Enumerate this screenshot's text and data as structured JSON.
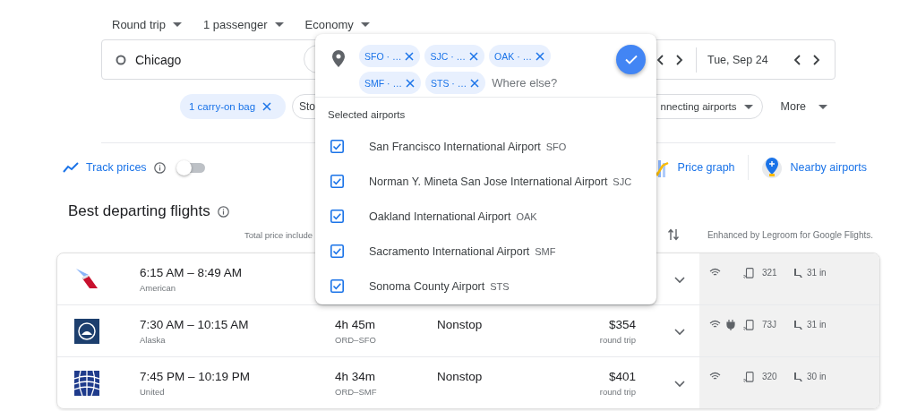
{
  "trip_options": [
    {
      "label": "Round trip"
    },
    {
      "label": "1 passenger"
    },
    {
      "label": "Economy"
    }
  ],
  "search": {
    "origin": "Chicago",
    "return_date": "Tue, Sep 24"
  },
  "filters": [
    {
      "label": "1 carry-on bag",
      "kind": "applied"
    },
    {
      "label": "Sto",
      "kind": "outlined"
    },
    {
      "label": "nnecting airports",
      "kind": "outlined"
    },
    {
      "label": "More",
      "kind": "plain"
    }
  ],
  "track_prices": {
    "label": "Track prices",
    "on": false
  },
  "tools": [
    {
      "label": "Price graph",
      "kind": "graph"
    },
    {
      "label": "Nearby airports",
      "kind": "nearby"
    }
  ],
  "results": {
    "title": "Best departing flights",
    "note": "Total price include",
    "credit": "Enhanced by Legroom for Google Flights.",
    "flights": [
      {
        "times": "6:15 AM – 8:49 AM",
        "airline": "American",
        "logo": {
          "kind": "tail"
        },
        "amenities": [
          {
            "kind": "wifi"
          },
          {
            "kind": "stream"
          }
        ],
        "aircraft": "321",
        "legroom": "31 in"
      },
      {
        "times": "7:30 AM – 10:15 AM",
        "airline": "Alaska",
        "logo": {
          "kind": "badge"
        },
        "duration": "4h 45m",
        "route": "ORD–SFO",
        "stops": "Nonstop",
        "price": "$354",
        "price_note": "round trip",
        "amenities": [
          {
            "kind": "wifi"
          },
          {
            "kind": "power"
          },
          {
            "kind": "stream"
          }
        ],
        "aircraft": "73J",
        "legroom": "31 in"
      },
      {
        "times": "7:45 PM – 10:19 PM",
        "airline": "United",
        "logo": {
          "kind": "globe"
        },
        "duration": "4h 34m",
        "route": "ORD–SMF",
        "stops": "Nonstop",
        "price": "$401",
        "price_note": "round trip",
        "amenities": [
          {
            "kind": "wifi"
          },
          {
            "kind": "stream"
          }
        ],
        "aircraft": "320",
        "legroom": "30 in"
      }
    ]
  },
  "destination_picker": {
    "chips": [
      {
        "label": "SFO · …"
      },
      {
        "label": "SJC · …"
      },
      {
        "label": "OAK · …"
      },
      {
        "label": "SMF · …"
      },
      {
        "label": "STS · …"
      }
    ],
    "placeholder": "Where else?",
    "section_title": "Selected airports",
    "airports": [
      {
        "name": "San Francisco International Airport",
        "code": "SFO",
        "checked": true
      },
      {
        "name": "Norman Y. Mineta San Jose International Airport",
        "code": "SJC",
        "checked": true
      },
      {
        "name": "Oakland International Airport",
        "code": "OAK",
        "checked": true
      },
      {
        "name": "Sacramento International Airport",
        "code": "SMF",
        "checked": true
      },
      {
        "name": "Sonoma County Airport",
        "code": "STS",
        "checked": true
      }
    ]
  }
}
